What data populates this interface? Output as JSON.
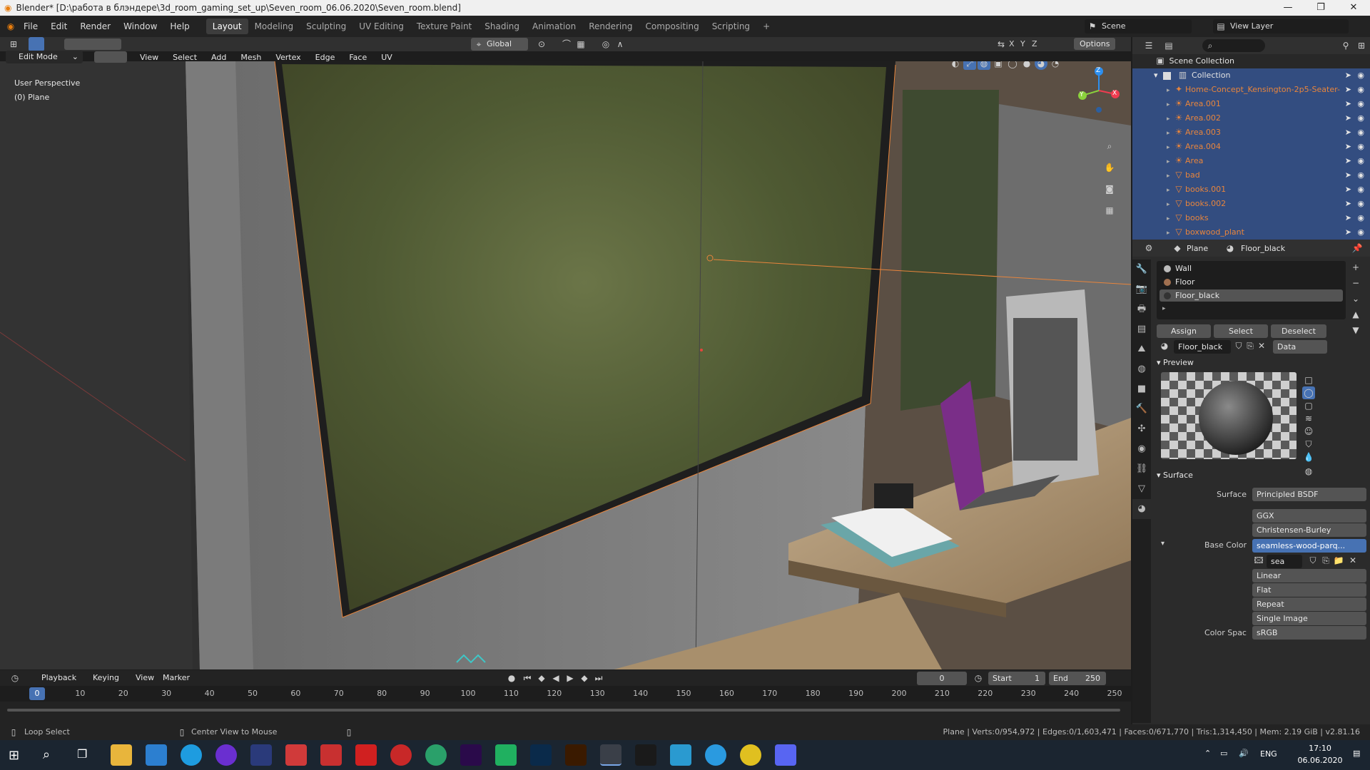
{
  "window": {
    "title": "Blender* [D:\\работа в блэндере\\3d_room_gaming_set_up\\Seven_room_06.06.2020\\Seven_room.blend]",
    "controls": [
      "—",
      "❐",
      "✕"
    ]
  },
  "top_menu": {
    "items": [
      "File",
      "Edit",
      "Render",
      "Window",
      "Help"
    ],
    "workspaces": [
      "Layout",
      "Modeling",
      "Sculpting",
      "UV Editing",
      "Texture Paint",
      "Shading",
      "Animation",
      "Rendering",
      "Compositing",
      "Scripting"
    ],
    "active_workspace": "Layout",
    "add_tab": "+",
    "scene_label": "Scene",
    "view_layer_label": "View Layer"
  },
  "viewport_header": {
    "mode": "Edit Mode",
    "menus": [
      "View",
      "Select",
      "Add",
      "Mesh",
      "Vertex",
      "Edge",
      "Face",
      "UV"
    ],
    "transform_orientation": "Global",
    "options_label": "Options",
    "axes": [
      "X",
      "Y",
      "Z"
    ]
  },
  "viewport": {
    "perspective_label": "User Perspective",
    "object_label": "(0) Plane",
    "gizmo_axes": [
      "Z",
      "X",
      "Y"
    ]
  },
  "outliner": {
    "root": "Scene Collection",
    "collection": "Collection",
    "items": [
      {
        "name": "Home-Concept_Kensington-2p5-Seater-",
        "icon": "armature-icon",
        "color": "#e8853c"
      },
      {
        "name": "Area.001",
        "icon": "light-icon",
        "color": "#e8853c"
      },
      {
        "name": "Area.002",
        "icon": "light-icon",
        "color": "#e8853c"
      },
      {
        "name": "Area.003",
        "icon": "light-icon",
        "color": "#e8853c"
      },
      {
        "name": "Area.004",
        "icon": "light-icon",
        "color": "#e8853c"
      },
      {
        "name": "Area",
        "icon": "light-icon",
        "color": "#e8853c"
      },
      {
        "name": "bad",
        "icon": "mesh-icon",
        "color": "#e8853c"
      },
      {
        "name": "books.001",
        "icon": "mesh-icon",
        "color": "#e8853c"
      },
      {
        "name": "books.002",
        "icon": "mesh-icon",
        "color": "#e8853c"
      },
      {
        "name": "books",
        "icon": "mesh-icon",
        "color": "#e8853c"
      },
      {
        "name": "boxwood_plant",
        "icon": "mesh-icon",
        "color": "#e8853c"
      }
    ]
  },
  "properties": {
    "breadcrumb_object": "Plane",
    "breadcrumb_material": "Floor_black",
    "material_slots": [
      "Wall",
      "Floor",
      "Floor_black"
    ],
    "active_slot": "Floor_black",
    "slot_buttons": [
      "Assign",
      "Select",
      "Deselect"
    ],
    "material_name": "Floor_black",
    "link_mode": "Data",
    "preview_title": "Preview",
    "surface_title": "Surface",
    "surface_label": "Surface",
    "surface_value": "Principled BSDF",
    "distribution": "GGX",
    "subsurface_method": "Christensen-Burley",
    "base_color_label": "Base Color",
    "base_color_value": "seamless-wood-parq...",
    "image_name": "sea",
    "interpolation": "Linear",
    "projection": "Flat",
    "extension": "Repeat",
    "source": "Single Image",
    "color_space_label": "Color Spac",
    "color_space_value": "sRGB"
  },
  "timeline": {
    "menus": [
      "Playback",
      "Keying",
      "View",
      "Marker"
    ],
    "current_frame": "0",
    "start_label": "Start",
    "start_value": "1",
    "end_label": "End",
    "end_value": "250",
    "ruler": [
      "0",
      "10",
      "20",
      "30",
      "40",
      "50",
      "60",
      "70",
      "80",
      "90",
      "100",
      "110",
      "120",
      "130",
      "140",
      "150",
      "160",
      "170",
      "180",
      "190",
      "200",
      "210",
      "220",
      "230",
      "240",
      "250"
    ],
    "playhead": "0"
  },
  "statusbar": {
    "hint_left": "Loop Select",
    "hint_mid": "Center View to Mouse",
    "stats": "Plane | Verts:0/954,972 | Edges:0/1,603,471 | Faces:0/671,770 | Tris:1,314,450 | Mem: 2.19 GiB | v2.81.16"
  },
  "taskbar": {
    "lang": "ENG",
    "time": "17:10",
    "date": "06.06.2020"
  },
  "colors": {
    "accent": "#4772b3",
    "selected_row": "#334d80",
    "object_orange": "#e8853c",
    "ui_bg": "#303030"
  }
}
